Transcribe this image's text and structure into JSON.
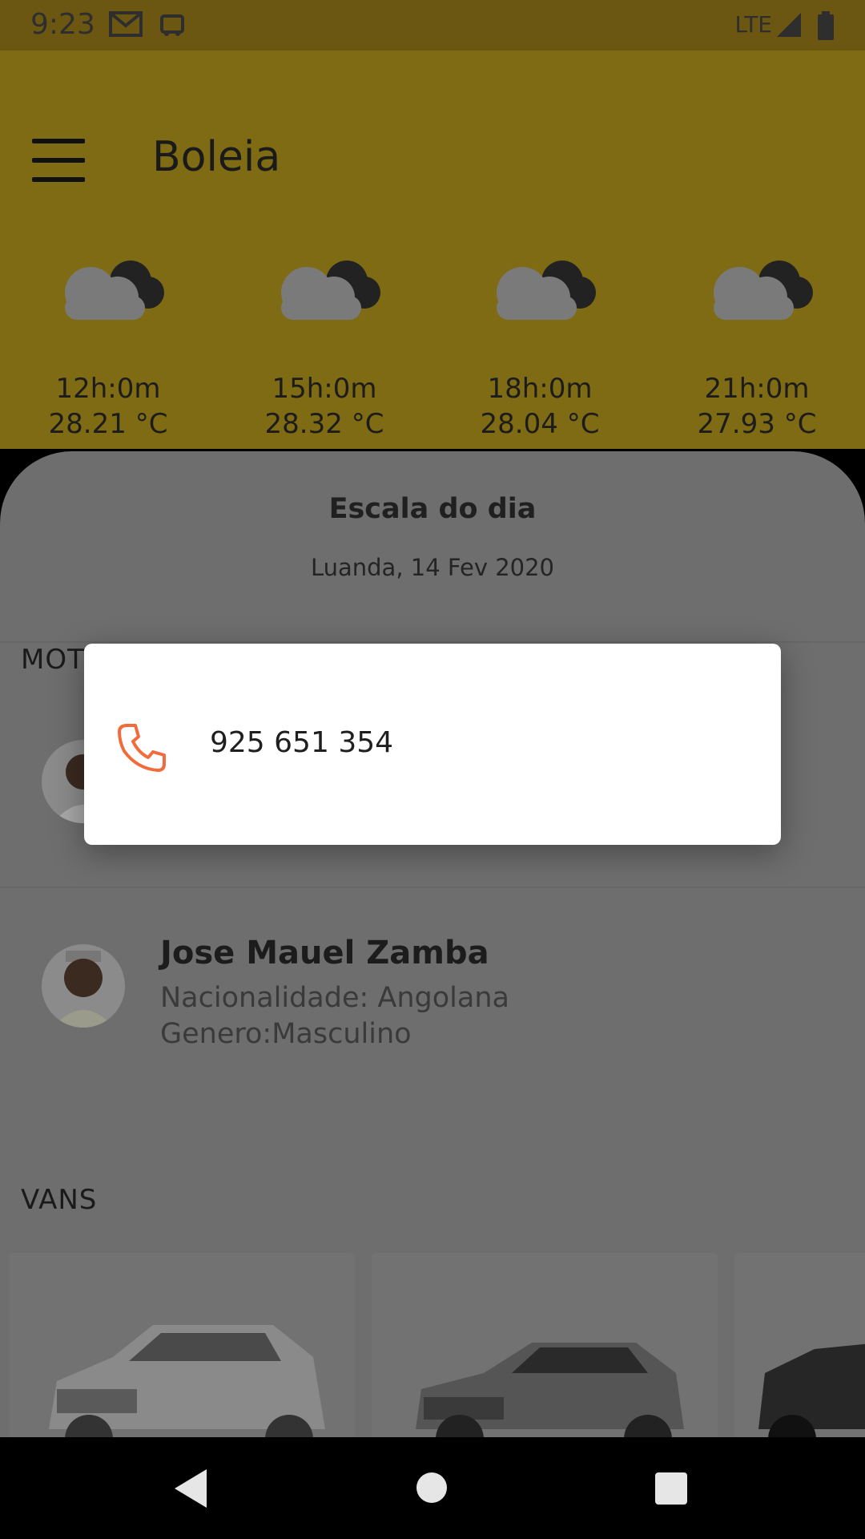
{
  "status_bar": {
    "time": "9:23",
    "network": "LTE"
  },
  "app_bar": {
    "title": "Boleia"
  },
  "weather": [
    {
      "time": "12h:0m",
      "temp": "28.21 °C",
      "icon": "cloudy-icon"
    },
    {
      "time": "15h:0m",
      "temp": "28.32 °C",
      "icon": "cloudy-icon"
    },
    {
      "time": "18h:0m",
      "temp": "28.04 °C",
      "icon": "cloudy-icon"
    },
    {
      "time": "21h:0m",
      "temp": "27.93 °C",
      "icon": "cloudy-icon"
    }
  ],
  "schedule": {
    "title": "Escala do dia",
    "subtitle": "Luanda, 14 Fev 2020"
  },
  "drivers_section": {
    "label": "MOT"
  },
  "drivers": [
    {
      "name": "Jose Mauel Zamba",
      "nationality": "Nacionalidade: Angolana",
      "gender": "Genero:Masculino"
    }
  ],
  "vans_section": {
    "label": "VANS"
  },
  "dialog": {
    "phone_number": "925 651 354",
    "icon": "phone-icon",
    "accent": "#f26b3a"
  },
  "colors": {
    "header": "#7f6b14",
    "scrim": "#6e6e6e",
    "dialog_bg": "#ffffff"
  }
}
